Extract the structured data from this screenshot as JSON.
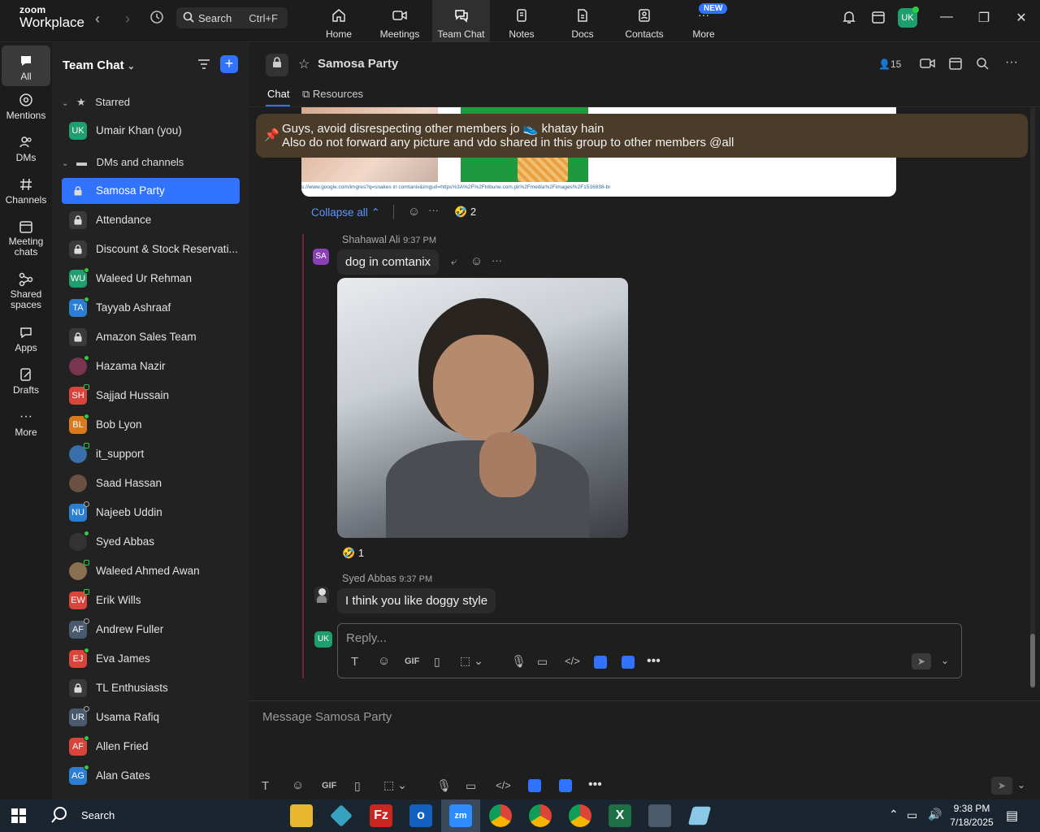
{
  "app": {
    "logo_top": "zoom",
    "logo_bottom": "Workplace"
  },
  "search": {
    "label": "Search",
    "shortcut": "Ctrl+F"
  },
  "topnav": [
    {
      "label": "Home",
      "icon": "home-icon"
    },
    {
      "label": "Meetings",
      "icon": "video-icon"
    },
    {
      "label": "Team Chat",
      "icon": "chat-icon"
    },
    {
      "label": "Notes",
      "icon": "notes-icon"
    },
    {
      "label": "Docs",
      "icon": "docs-icon"
    },
    {
      "label": "Contacts",
      "icon": "contacts-icon"
    },
    {
      "label": "More",
      "icon": "more-icon"
    }
  ],
  "new_badge": "NEW",
  "user_avatar": "UK",
  "rail": [
    {
      "label": "All",
      "icon": "chat-icon"
    },
    {
      "label": "Mentions",
      "icon": "at-icon"
    },
    {
      "label": "DMs",
      "icon": "people-icon"
    },
    {
      "label": "Channels",
      "icon": "hash-icon"
    },
    {
      "label": "Meeting chats",
      "icon": "calendar-icon"
    },
    {
      "label": "Shared spaces",
      "icon": "share-icon"
    },
    {
      "label": "Apps",
      "icon": "apps-icon"
    },
    {
      "label": "Drafts",
      "icon": "drafts-icon"
    },
    {
      "label": "More",
      "icon": "dots-icon"
    }
  ],
  "sidebar": {
    "title": "Team Chat",
    "starred_label": "Starred",
    "starred": [
      {
        "name": "Umair Khan (you)",
        "initials": "UK",
        "color": "#1f9e6e",
        "status": "none"
      }
    ],
    "dms_label": "DMs and channels",
    "items": [
      {
        "name": "Samosa Party",
        "initials": "",
        "type": "lock",
        "color": "",
        "status": "none"
      },
      {
        "name": "Attendance",
        "initials": "",
        "type": "lock",
        "color": "",
        "status": "none"
      },
      {
        "name": "Discount & Stock Reservati...",
        "initials": "",
        "type": "lock",
        "color": "",
        "status": "none"
      },
      {
        "name": "Waleed Ur Rehman",
        "initials": "WU",
        "type": "user",
        "color": "#1f9e6e",
        "status": "online"
      },
      {
        "name": "Tayyab Ashraaf",
        "initials": "TA",
        "type": "user",
        "color": "#2a7fd4",
        "status": "online"
      },
      {
        "name": "Amazon Sales Team",
        "initials": "",
        "type": "lock",
        "color": "",
        "status": "none"
      },
      {
        "name": "Hazama Nazir",
        "initials": "",
        "type": "photo",
        "color": "#7a3550",
        "status": "online"
      },
      {
        "name": "Sajjad Hussain",
        "initials": "SH",
        "type": "user",
        "color": "#d9453b",
        "status": "phone"
      },
      {
        "name": "Bob Lyon",
        "initials": "BL",
        "type": "user",
        "color": "#d97a1f",
        "status": "online"
      },
      {
        "name": "it_support",
        "initials": "",
        "type": "photo",
        "color": "#3a6ea8",
        "status": "phone"
      },
      {
        "name": "Saad Hassan",
        "initials": "",
        "type": "photo",
        "color": "#6a5040",
        "status": "none"
      },
      {
        "name": "Najeeb Uddin",
        "initials": "NU",
        "type": "user",
        "color": "#2a7fd4",
        "status": "offline"
      },
      {
        "name": "Syed Abbas",
        "initials": "",
        "type": "photo",
        "color": "#333",
        "status": "online"
      },
      {
        "name": "Waleed Ahmed Awan",
        "initials": "",
        "type": "photo",
        "color": "#8a7050",
        "status": "phone"
      },
      {
        "name": "Erik Wills",
        "initials": "EW",
        "type": "user",
        "color": "#d9453b",
        "status": "phone"
      },
      {
        "name": "Andrew Fuller",
        "initials": "AF",
        "type": "user",
        "color": "#4a5a6e",
        "status": "offline"
      },
      {
        "name": "Eva James",
        "initials": "EJ",
        "type": "user",
        "color": "#d9453b",
        "status": "online"
      },
      {
        "name": "TL Enthusiasts",
        "initials": "",
        "type": "lock",
        "color": "",
        "status": "none"
      },
      {
        "name": "Usama Rafiq",
        "initials": "UR",
        "type": "user",
        "color": "#4a5a6e",
        "status": "offline"
      },
      {
        "name": "Allen Fried",
        "initials": "AF",
        "type": "user",
        "color": "#d9453b",
        "status": "online"
      },
      {
        "name": "Alan Gates",
        "initials": "AG",
        "type": "user",
        "color": "#2a7fd4",
        "status": "online"
      }
    ]
  },
  "channel": {
    "name": "Samosa Party",
    "members": "15",
    "tabs": [
      "Chat",
      "Resources"
    ]
  },
  "pinned": {
    "line1": "Guys, avoid disrespecting other members jo 👟 khatay hain",
    "line2": "Also do not forward any picture and vdo shared in this group to other members @all"
  },
  "link_preview_url": "s://www.google.com/imgres?q=snakes in comtanix&imgurl=https%3A%2F%2Ftribune.com.pk%2Fmedia%2Fimages%2F1516838-bro",
  "thread": {
    "collapse_label": "Collapse all",
    "reaction_count": "2",
    "messages": [
      {
        "author": "Shahawal Ali",
        "time": "9:37 PM",
        "initials": "SA",
        "text": "dog in comtanix",
        "reaction_count": "1"
      },
      {
        "author": "Syed Abbas",
        "time": "9:37 PM",
        "initials": "",
        "text": "I think you like doggy style"
      }
    ],
    "reply_placeholder": "Reply...",
    "reply_avatar": "UK"
  },
  "composer": {
    "placeholder": "Message Samosa Party",
    "gif": "GIF"
  },
  "taskbar": {
    "search": "Search",
    "time": "9:38 PM",
    "date": "7/18/2025"
  },
  "colors": {
    "accent": "#2f73ff",
    "online": "#2ecc40",
    "pinned_bg": "#4a3c28"
  }
}
